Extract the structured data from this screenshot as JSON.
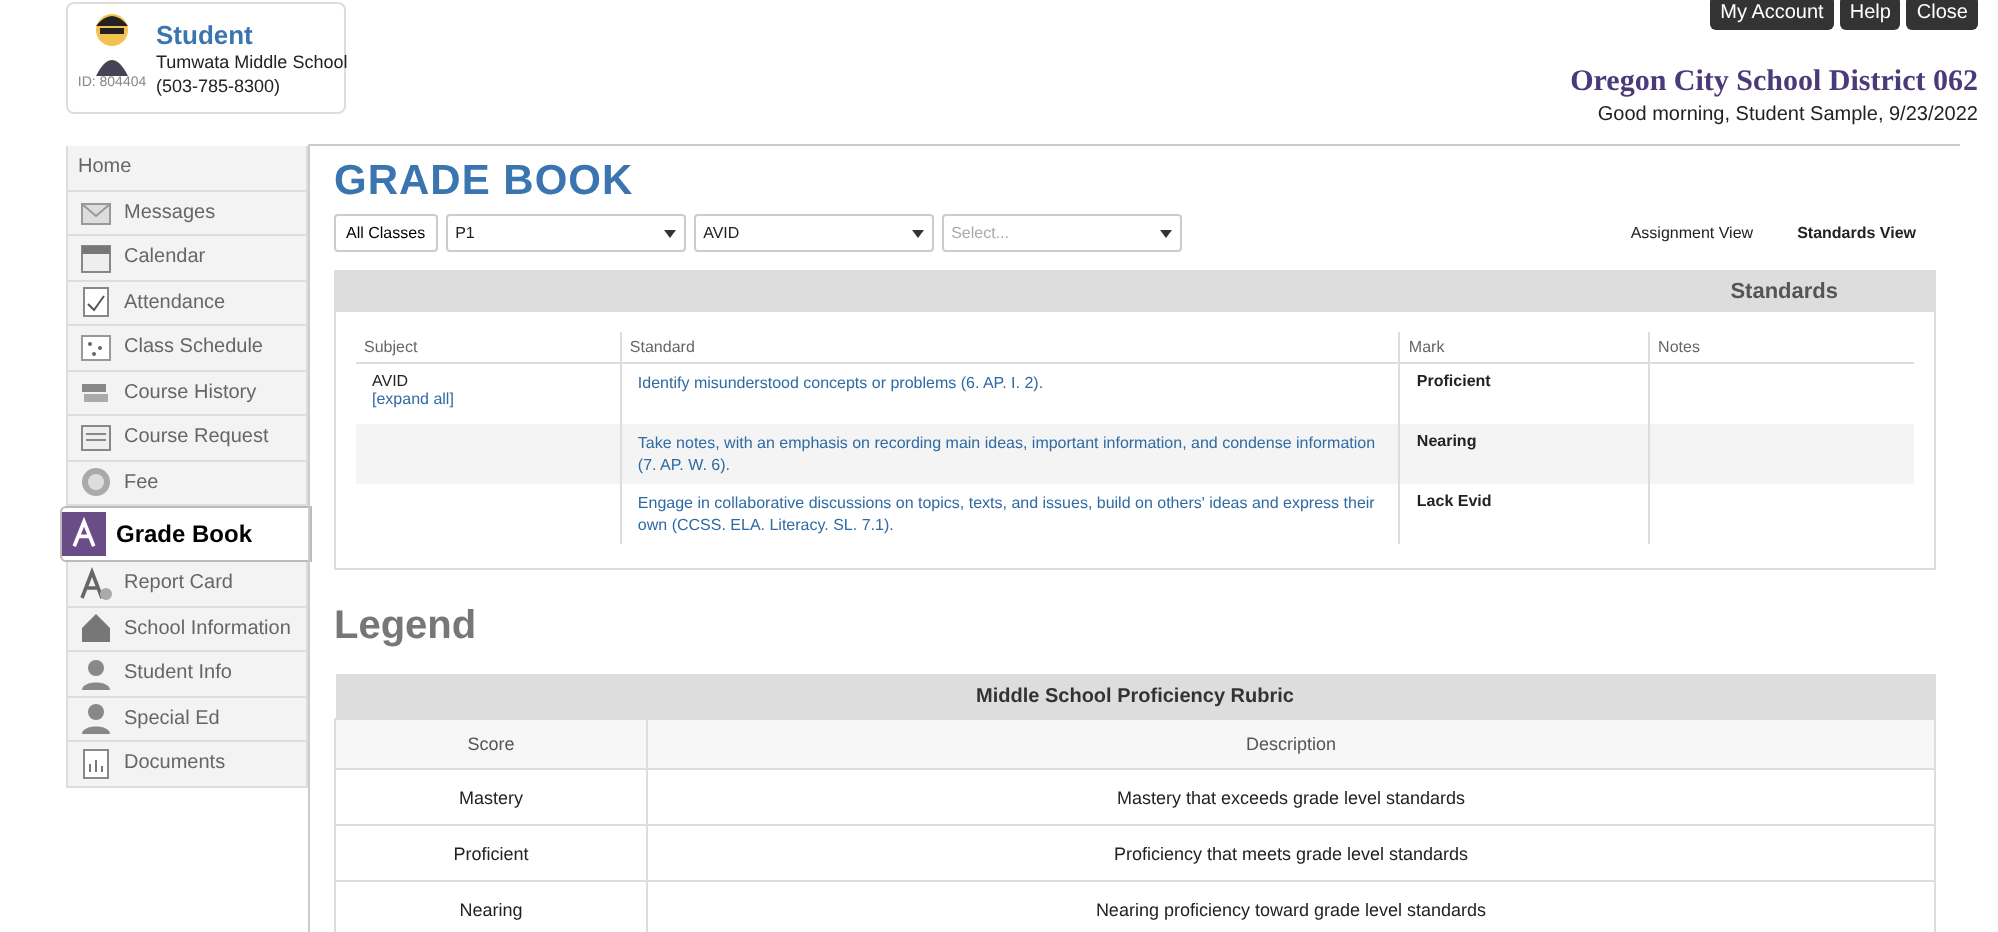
{
  "student": {
    "title": "Student",
    "school": "Tumwata Middle School",
    "phone": "(503-785-8300)",
    "id": "ID: 804404"
  },
  "top_buttons": [
    "My Account",
    "Help",
    "Close"
  ],
  "district": "Oregon City School District 062",
  "greeting": "Good morning, Student Sample, 9/23/2022",
  "sidebar": {
    "items": [
      {
        "label": "Home",
        "selected": false
      },
      {
        "label": "Messages",
        "selected": false
      },
      {
        "label": "Calendar",
        "selected": false
      },
      {
        "label": "Attendance",
        "selected": false
      },
      {
        "label": "Class Schedule",
        "selected": false
      },
      {
        "label": "Course History",
        "selected": false
      },
      {
        "label": "Course Request",
        "selected": false
      },
      {
        "label": "Fee",
        "selected": false
      },
      {
        "label": "Grade Book",
        "selected": true
      },
      {
        "label": "Report Card",
        "selected": false
      },
      {
        "label": "School Information",
        "selected": false
      },
      {
        "label": "Student Info",
        "selected": false
      },
      {
        "label": "Special Ed",
        "selected": false
      },
      {
        "label": "Documents",
        "selected": false
      }
    ]
  },
  "page_title": "GRADE BOOK",
  "filters": {
    "button": "All Classes",
    "selects": [
      {
        "value": "P1"
      },
      {
        "value": "AVID"
      },
      {
        "placeholder": "Select..."
      }
    ]
  },
  "views": [
    {
      "label": "Assignment View",
      "selected": false
    },
    {
      "label": "Standards View",
      "selected": true
    }
  ],
  "standards": {
    "header": "Standards",
    "columns": [
      "Subject",
      "Standard",
      "Mark",
      "Notes"
    ],
    "subject": "AVID",
    "expand_link": "[expand all]",
    "rows": [
      {
        "standard": "Identify misunderstood concepts or problems (6. AP. I. 2).",
        "mark": "Proficient"
      },
      {
        "standard": "Take notes, with an emphasis on recording main ideas, important information, and condense information (7. AP. W. 6).",
        "mark": "Nearing"
      },
      {
        "standard": "Engage in collaborative discussions on topics, texts, and issues, build on others' ideas and express their own (CCSS. ELA. Literacy. SL. 7.1).",
        "mark": "Lack Evid"
      }
    ]
  },
  "legend": {
    "title": "Legend",
    "table_title": "Middle School Proficiency Rubric",
    "columns": [
      "Score",
      "Description"
    ],
    "rows": [
      {
        "score": "Mastery",
        "description": "Mastery that exceeds grade level standards"
      },
      {
        "score": "Proficient",
        "description": "Proficiency that meets grade level standards"
      },
      {
        "score": "Nearing",
        "description": "Nearing proficiency toward grade level standards"
      }
    ]
  }
}
